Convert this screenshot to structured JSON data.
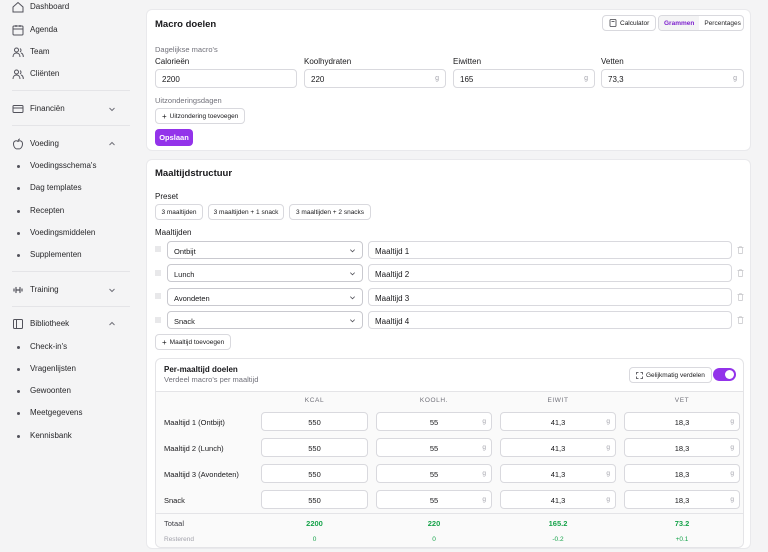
{
  "sidebar": {
    "dashboard": "Dashboard",
    "agenda": "Agenda",
    "team": "Team",
    "clients": "Cliënten",
    "finance": "Financiën",
    "nutrition": "Voeding",
    "nutrition_items": [
      "Voedingsschema's",
      "Dag templates",
      "Recepten",
      "Voedingsmiddelen",
      "Supplementen"
    ],
    "training": "Training",
    "library": "Bibliotheek",
    "library_items": [
      "Check-in's",
      "Vragenlijsten",
      "Gewoonten",
      "Meetgegevens",
      "Kennisbank"
    ]
  },
  "macro": {
    "title": "Macro doelen",
    "calculator": "Calculator",
    "mode_grams": "Grammen",
    "mode_percent": "Percentages",
    "daily_label": "Dagelijkse macro's",
    "fields": [
      {
        "label": "Calorieën",
        "value": "2200",
        "unit": ""
      },
      {
        "label": "Koolhydraten",
        "value": "220",
        "unit": "g"
      },
      {
        "label": "Eiwitten",
        "value": "165",
        "unit": "g"
      },
      {
        "label": "Vetten",
        "value": "73,3",
        "unit": "g"
      }
    ],
    "exceptions_label": "Uitzonderingsdagen",
    "add_exception": "Uitzondering toevoegen",
    "save": "Opslaan"
  },
  "meals": {
    "title": "Maaltijdstructuur",
    "preset_label": "Preset",
    "presets": [
      "3 maaltijden",
      "3 maaltijden + 1 snack",
      "3 maaltijden + 2 snacks"
    ],
    "list_label": "Maaltijden",
    "rows": [
      {
        "type": "Ontbijt",
        "name": "Maaltijd 1"
      },
      {
        "type": "Lunch",
        "name": "Maaltijd 2"
      },
      {
        "type": "Avondeten",
        "name": "Maaltijd 3"
      },
      {
        "type": "Snack",
        "name": "Maaltijd 4"
      }
    ],
    "add_meal": "Maaltijd toevoegen"
  },
  "per_meal": {
    "title": "Per-maaltijd doelen",
    "subtitle": "Verdeel macro's per maaltijd",
    "distribute": "Gelijkmatig verdelen",
    "toggle_on": true,
    "columns": [
      "KCAL",
      "KOOLH.",
      "EIWIT",
      "VET"
    ],
    "unit": "g",
    "rows": [
      {
        "label": "Maaltijd 1 (Ontbijt)",
        "values": [
          "550",
          "55",
          "41,3",
          "18,3"
        ]
      },
      {
        "label": "Maaltijd 2 (Lunch)",
        "values": [
          "550",
          "55",
          "41,3",
          "18,3"
        ]
      },
      {
        "label": "Maaltijd 3 (Avondeten)",
        "values": [
          "550",
          "55",
          "41,3",
          "18,3"
        ]
      },
      {
        "label": "Snack",
        "values": [
          "550",
          "55",
          "41,3",
          "18,3"
        ]
      }
    ],
    "total_label": "Totaal",
    "totals": [
      "2200",
      "220",
      "165.2",
      "73.2"
    ],
    "remaining_label": "Resterend",
    "remaining": [
      "0",
      "0",
      "-0.2",
      "+0.1"
    ],
    "accent": "#9333ea",
    "positive": "#16a34a"
  }
}
